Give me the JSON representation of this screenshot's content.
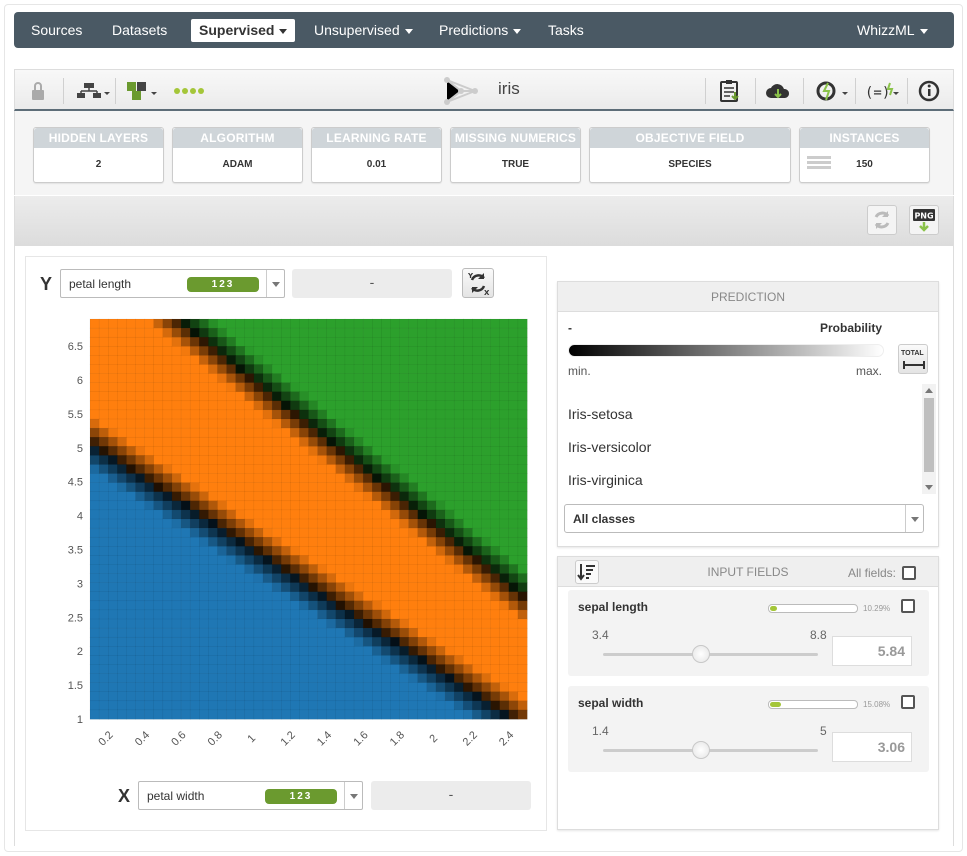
{
  "nav": {
    "items": [
      {
        "label": "Sources"
      },
      {
        "label": "Datasets"
      },
      {
        "label": "Supervised"
      },
      {
        "label": "Unsupervised"
      },
      {
        "label": "Predictions"
      },
      {
        "label": "Tasks"
      },
      {
        "label": "WhizzML"
      }
    ]
  },
  "toolbar": {
    "title": "iris"
  },
  "summary": {
    "cards": [
      {
        "header": "HIDDEN LAYERS",
        "value": "2"
      },
      {
        "header": "ALGORITHM",
        "value": "ADAM"
      },
      {
        "header": "LEARNING RATE",
        "value": "0.01"
      },
      {
        "header": "MISSING NUMERICS",
        "value": "TRUE"
      },
      {
        "header": "OBJECTIVE FIELD",
        "value": "SPECIES"
      },
      {
        "header": "INSTANCES",
        "value": "150"
      }
    ]
  },
  "plot": {
    "y_label": "Y",
    "x_label": "X",
    "y_field": "petal length",
    "x_field": "petal width",
    "type_badge": "123",
    "y_value": "-",
    "x_value": "-"
  },
  "chart_data": {
    "type": "heatmap",
    "x_ticks": [
      "0.2",
      "0.4",
      "0.6",
      "0.8",
      "1",
      "1.2",
      "1.4",
      "1.6",
      "1.8",
      "2",
      "2.2",
      "2.4"
    ],
    "y_ticks": [
      "1",
      "1.5",
      "2",
      "2.5",
      "3",
      "3.5",
      "4",
      "4.5",
      "5",
      "5.5",
      "6",
      "6.5"
    ],
    "xlim": [
      0.1,
      2.5
    ],
    "ylim": [
      1.0,
      6.9
    ],
    "classes": [
      {
        "name": "Iris-setosa",
        "color": "#1f77b4"
      },
      {
        "name": "Iris-versicolor",
        "color": "#ff7f0e"
      },
      {
        "name": "Iris-virginica",
        "color": "#2ca02c"
      }
    ]
  },
  "prediction": {
    "header": "PREDICTION",
    "pred_value": "-",
    "prob_label": "Probability",
    "min_label": "min.",
    "max_label": "max.",
    "total_label": "TOTAL",
    "classes": [
      "Iris-setosa",
      "Iris-versicolor",
      "Iris-virginica"
    ],
    "class_select": "All classes"
  },
  "inputs": {
    "header": "INPUT FIELDS",
    "all_fields_label": "All fields:",
    "fields": [
      {
        "name": "sepal length",
        "importance": "10.29%",
        "importance_value": 10.29,
        "min": "3.4",
        "max": "8.8",
        "value": "5.84"
      },
      {
        "name": "sepal width",
        "importance": "15.08%",
        "importance_value": 15.08,
        "min": "1.4",
        "max": "5",
        "value": "3.06"
      }
    ]
  }
}
